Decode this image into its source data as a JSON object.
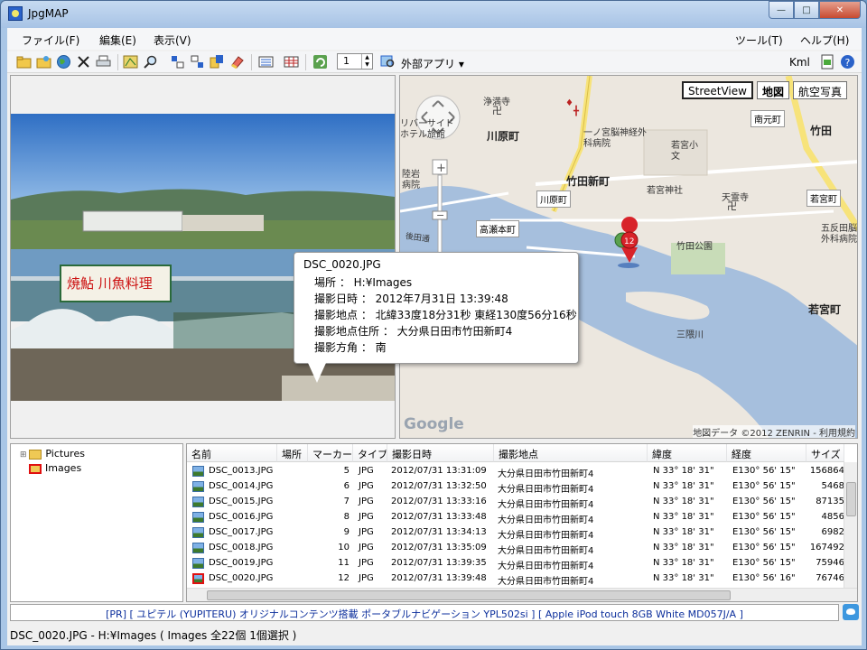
{
  "window": {
    "title": "JpgMAP",
    "buttons": {
      "minimize": "—",
      "maximize": "□",
      "close": "✕"
    }
  },
  "menubar": {
    "items": [
      "ファイル(F)",
      "編集(E)",
      "表示(V)"
    ],
    "right_items": [
      "ツール(T)",
      "ヘルプ(H)"
    ]
  },
  "toolbar": {
    "zoom_value": "1",
    "external_app_label": "外部アプリ ▾",
    "kml_label": "Kml"
  },
  "map": {
    "streetview_label": "StreetView",
    "map_label": "地図",
    "aerial_label": "航空写真",
    "copyright": "地図データ ©2012 ZENRIN - 利用規約",
    "google_logo": "Google",
    "marker_number": "12",
    "place_labels": [
      "浄満寺",
      "川原町",
      "一ノ宮脳神経外科病院",
      "竹田新町",
      "川原町",
      "陸岩病院",
      "若宮小文",
      "若宮神社",
      "天霊寺",
      "南元町",
      "竹田",
      "若宮町",
      "高瀬本町",
      "後田通",
      "竹田公園",
      "三隈川",
      "五反田脳外科病院",
      "若宮町",
      "リバーサイドホテル旅館"
    ]
  },
  "tooltip": {
    "filename": "DSC_0020.JPG",
    "place": "場所 ： H:¥Images",
    "datetime": "撮影日時 ： 2012年7月31日 13:39:48",
    "coords": "撮影地点 ： 北緯33度18分31秒 東経130度56分16秒",
    "address": "撮影地点住所 ： 大分県日田市竹田新町4",
    "direction": "撮影方角 ： 南"
  },
  "photo": {
    "sign_text": "焼鮎 川魚料理"
  },
  "tree": {
    "items": [
      "Pictures",
      "Images"
    ]
  },
  "list": {
    "headers": [
      "名前",
      "場所",
      "マーカー",
      "タイプ",
      "撮影日時",
      "撮影地点",
      "緯度",
      "経度",
      "サイズ"
    ],
    "rows": [
      [
        "DSC_0013.JPG",
        "",
        "5",
        "JPG",
        "2012/07/31 13:31:09",
        "大分県日田市竹田新町4",
        "N 33° 18' 31\"",
        "E130° 56' 15\"",
        "156864"
      ],
      [
        "DSC_0014.JPG",
        "",
        "6",
        "JPG",
        "2012/07/31 13:32:50",
        "大分県日田市竹田新町4",
        "N 33° 18' 31\"",
        "E130° 56' 15\"",
        "5468"
      ],
      [
        "DSC_0015.JPG",
        "",
        "7",
        "JPG",
        "2012/07/31 13:33:16",
        "大分県日田市竹田新町4",
        "N 33° 18' 31\"",
        "E130° 56' 15\"",
        "87135"
      ],
      [
        "DSC_0016.JPG",
        "",
        "8",
        "JPG",
        "2012/07/31 13:33:48",
        "大分県日田市竹田新町4",
        "N 33° 18' 31\"",
        "E130° 56' 15\"",
        "4856"
      ],
      [
        "DSC_0017.JPG",
        "",
        "9",
        "JPG",
        "2012/07/31 13:34:13",
        "大分県日田市竹田新町4",
        "N 33° 18' 31\"",
        "E130° 56' 15\"",
        "6982"
      ],
      [
        "DSC_0018.JPG",
        "",
        "10",
        "JPG",
        "2012/07/31 13:35:09",
        "大分県日田市竹田新町4",
        "N 33° 18' 31\"",
        "E130° 56' 15\"",
        "167492"
      ],
      [
        "DSC_0019.JPG",
        "",
        "11",
        "JPG",
        "2012/07/31 13:39:35",
        "大分県日田市竹田新町4",
        "N 33° 18' 31\"",
        "E130° 56' 15\"",
        "75946"
      ],
      [
        "DSC_0020.JPG",
        "",
        "12",
        "JPG",
        "2012/07/31 13:39:48",
        "大分県日田市竹田新町4",
        "N 33° 18' 31\"",
        "E130° 56' 16\"",
        "76746"
      ]
    ],
    "selected_index": 7
  },
  "pr_bar": {
    "text": "[PR] [ ユピテル (YUPITERU) オリジナルコンテンツ搭載 ポータブルナビゲーション YPL502si ] [ Apple iPod touch 8GB White MD057J/A ]"
  },
  "status": {
    "text": "DSC_0020.JPG - H:¥Images ( Images 全22個 1個選択 )"
  },
  "colors": {
    "titlebar": "#b8d0ec",
    "river": "#a6bfdd",
    "map_bg": "#ece7df",
    "road_yellow": "#f7e37a",
    "marker_red": "#d8232a",
    "pr_text": "#0c2f9c"
  }
}
